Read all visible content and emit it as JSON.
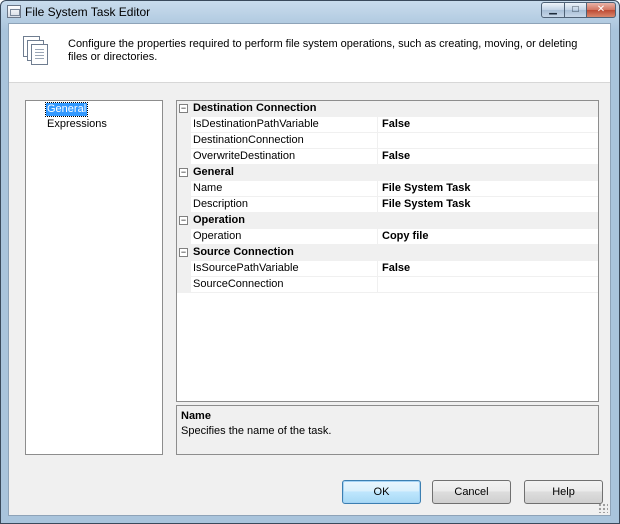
{
  "window": {
    "title": "File System Task Editor",
    "controls": {
      "minimize_glyph": "▁",
      "maximize_glyph": "□",
      "close_glyph": "✕"
    }
  },
  "header": {
    "icon": "documents-icon",
    "description": "Configure the properties required to perform file system operations, such as creating, moving, or deleting files or directories."
  },
  "nav": {
    "items": [
      {
        "label": "General",
        "selected": true
      },
      {
        "label": "Expressions",
        "selected": false
      }
    ]
  },
  "property_grid": {
    "categories": [
      {
        "label": "Destination Connection",
        "collapse_glyph": "−",
        "properties": [
          {
            "name": "IsDestinationPathVariable",
            "value": "False"
          },
          {
            "name": "DestinationConnection",
            "value": ""
          },
          {
            "name": "OverwriteDestination",
            "value": "False"
          }
        ]
      },
      {
        "label": "General",
        "collapse_glyph": "−",
        "properties": [
          {
            "name": "Name",
            "value": "File System Task"
          },
          {
            "name": "Description",
            "value": "File System Task"
          }
        ]
      },
      {
        "label": "Operation",
        "collapse_glyph": "−",
        "properties": [
          {
            "name": "Operation",
            "value": "Copy file"
          }
        ]
      },
      {
        "label": "Source Connection",
        "collapse_glyph": "−",
        "properties": [
          {
            "name": "IsSourcePathVariable",
            "value": "False"
          },
          {
            "name": "SourceConnection",
            "value": ""
          }
        ]
      }
    ]
  },
  "description_pane": {
    "title": "Name",
    "text": "Specifies the name of the task."
  },
  "buttons": {
    "ok": "OK",
    "cancel": "Cancel",
    "help": "Help"
  },
  "colors": {
    "selection": "#3399ff",
    "titlebar": "#a9c4dc",
    "dialog_bg": "#f0f0f0"
  }
}
